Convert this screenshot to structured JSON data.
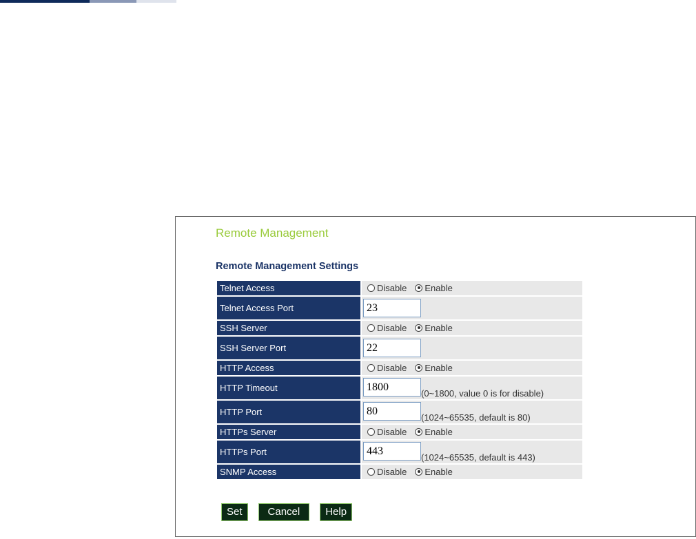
{
  "colors": {
    "accent_green": "#9acb3c",
    "label_bg": "#1b3567",
    "value_bg": "#e8e8e8",
    "button_bg": "#0b2a14"
  },
  "page": {
    "title": "Remote Management",
    "section_title": "Remote Management Settings"
  },
  "radio_labels": {
    "disable": "Disable",
    "enable": "Enable"
  },
  "settings": {
    "telnet_access": {
      "label": "Telnet Access",
      "selected": "Enable"
    },
    "telnet_access_port": {
      "label": "Telnet Access Port",
      "value": "23"
    },
    "ssh_server": {
      "label": "SSH Server",
      "selected": "Enable"
    },
    "ssh_server_port": {
      "label": "SSH Server Port",
      "value": "22"
    },
    "http_access": {
      "label": "HTTP Access",
      "selected": "Enable"
    },
    "http_timeout": {
      "label": "HTTP Timeout",
      "value": "1800",
      "hint": "(0~1800, value 0 is for disable)"
    },
    "http_port": {
      "label": "HTTP Port",
      "value": "80",
      "hint": "(1024~65535, default is 80)"
    },
    "https_server": {
      "label": "HTTPs Server",
      "selected": "Enable"
    },
    "https_port": {
      "label": "HTTPs Port",
      "value": "443",
      "hint": "(1024~65535, default is 443)"
    },
    "snmp_access": {
      "label": "SNMP Access",
      "selected": "Enable"
    }
  },
  "buttons": {
    "set": "Set",
    "cancel": "Cancel",
    "help": "Help"
  }
}
